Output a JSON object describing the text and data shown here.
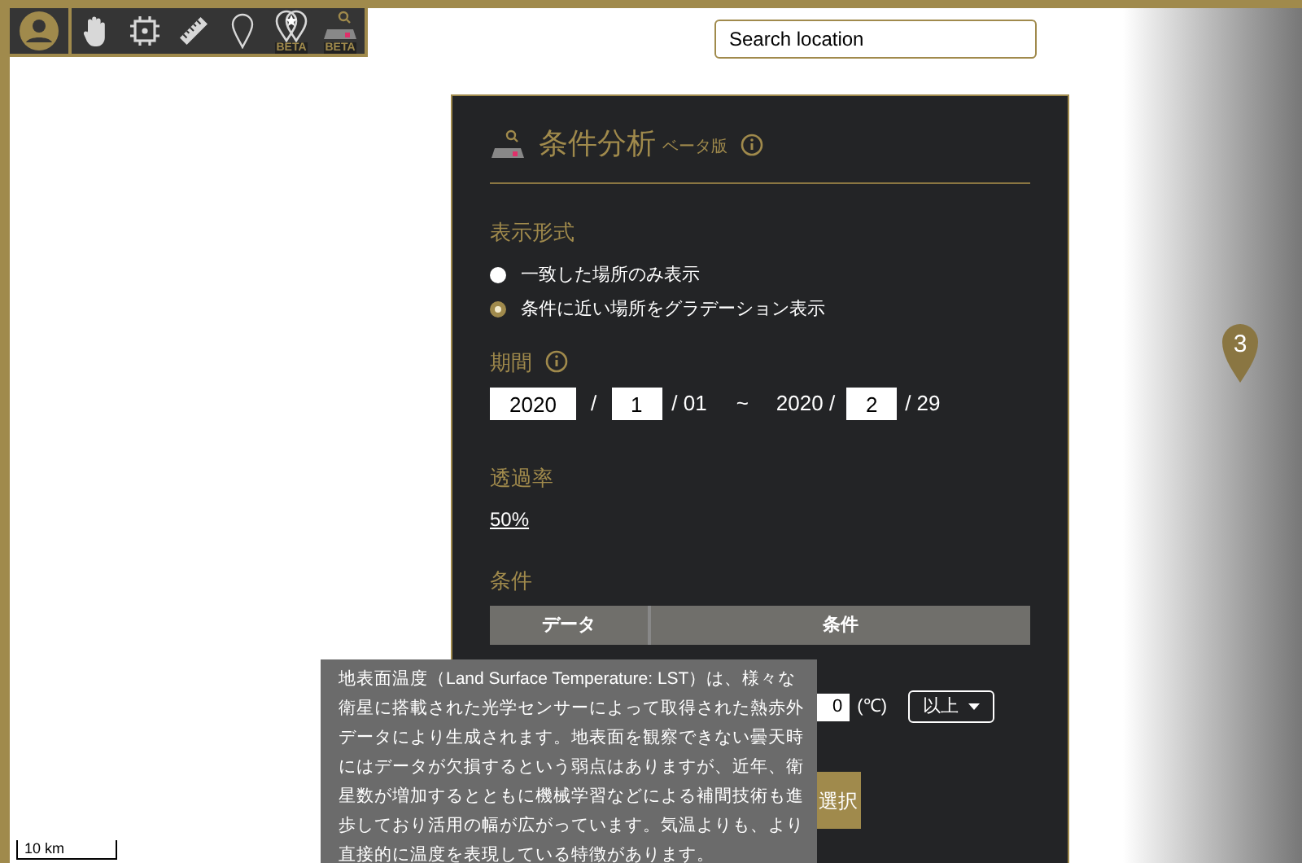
{
  "toolbar": {
    "tools": [
      {
        "kind": "hand"
      },
      {
        "kind": "frame"
      },
      {
        "kind": "ruler"
      },
      {
        "kind": "pin"
      },
      {
        "kind": "starpin",
        "badge": "BETA"
      },
      {
        "kind": "analysis",
        "badge": "BETA"
      }
    ]
  },
  "search": {
    "placeholder": "Search location"
  },
  "marker": {
    "label": "3"
  },
  "scale": {
    "label": "10 km"
  },
  "panel": {
    "title": "条件分析",
    "subtitle": "ベータ版",
    "display": {
      "label": "表示形式",
      "options": [
        {
          "label": "一致した場所のみ表示",
          "selected": false
        },
        {
          "label": "条件に近い場所をグラデーション表示",
          "selected": true
        }
      ]
    },
    "period": {
      "label": "期間",
      "start_year": "2020",
      "sep1": "/",
      "start_month": "1",
      "start_day": "/ 01",
      "tilde": "~",
      "end_year": "2020 /",
      "end_month": "2",
      "end_day": "/ 29"
    },
    "opacity": {
      "label": "透過率",
      "value": "50%"
    },
    "conditions": {
      "label": "条件",
      "columns": [
        "データ",
        "条件"
      ],
      "value": "0",
      "unit": "(℃)",
      "operator": "以上"
    },
    "next_button": "選択"
  },
  "tooltip": "地表面温度（Land Surface Temperature: LST）は、様々な衛星に搭載された光学センサーによって取得された熱赤外データにより生成されます。地表面を観察できない曇天時にはデータが欠損するという弱点はありますが、近年、衛星数が増加するとともに機械学習などによる補間技術も進歩しており活用の幅が広がっています。気温よりも、より直接的に温度を表現している特徴があります。"
}
